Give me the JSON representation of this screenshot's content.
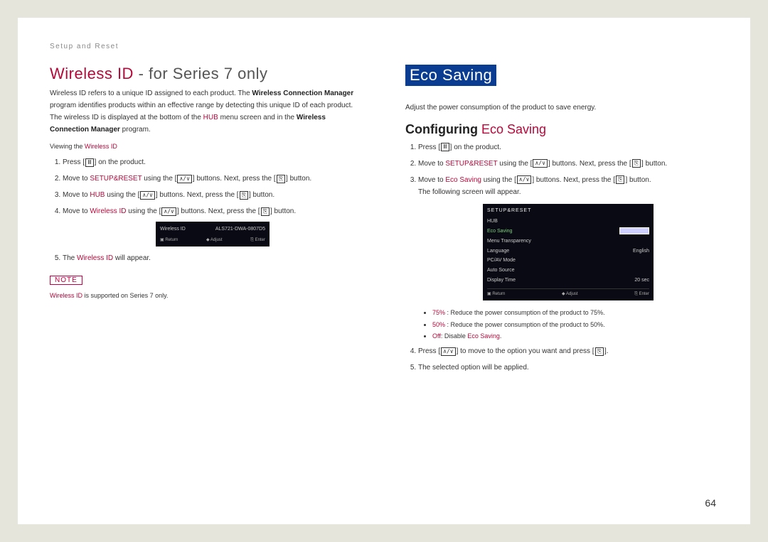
{
  "breadcrumb": "Setup and Reset",
  "left": {
    "h1_accent": "Wireless ID",
    "h1_rest": " - for Series 7 only",
    "intro_part1": "Wireless ID refers to a unique ID assigned to each product. The ",
    "intro_bold1": "Wireless Connection Manager",
    "intro_part2": " program identifies products within an effective range by detecting this unique ID of each product. The wireless ID is displayed at the bottom of the ",
    "intro_hl1": "HUB",
    "intro_part3": " menu screen and in the ",
    "intro_bold2": "Wireless Connection Manager",
    "intro_part4": " program.",
    "view_label_pre": "Viewing the ",
    "view_label_hl": "Wireless ID",
    "steps": {
      "s1_a": "Press [",
      "s1_b": "] on the product.",
      "s2_a": "Move to ",
      "s2_hl": "SETUP&RESET",
      "s2_b": " using the [",
      "s2_c": "] buttons. Next, press the [",
      "s2_d": "] button.",
      "s3_a": "Move to ",
      "s3_hl": "HUB",
      "s3_b": " using the [",
      "s3_c": "] buttons. Next, press the [",
      "s3_d": "] button.",
      "s4_a": "Move to ",
      "s4_hl": "Wireless ID",
      "s4_b": " using the [",
      "s4_c": "] buttons. Next, press the [",
      "s4_d": "] button.",
      "s5_a": "The ",
      "s5_hl": "Wireless ID",
      "s5_b": " will appear."
    },
    "osd": {
      "label": "Wireless ID",
      "value": "ALS721-DWA-0807D5",
      "f1": "Return",
      "f2": "Adjust",
      "f3": "Enter"
    },
    "note_badge": "NOTE",
    "note_hl": "Wireless ID",
    "note_rest": " is supported on Series 7 only."
  },
  "right": {
    "h1": "Eco Saving",
    "intro": "Adjust the power consumption of the product to save energy.",
    "h2_a": "Configuring ",
    "h2_b": "Eco Saving",
    "steps": {
      "s1_a": "Press [",
      "s1_b": "] on the product.",
      "s2_a": "Move to ",
      "s2_hl": "SETUP&RESET",
      "s2_b": " using the [",
      "s2_c": "] buttons. Next, press the [",
      "s2_d": "] button.",
      "s3_a": "Move to ",
      "s3_hl": "Eco Saving",
      "s3_b": " using the [",
      "s3_c": "] buttons. Next, press the [",
      "s3_d": "] button.",
      "s3_e": "The following screen will appear.",
      "s4_a": "Press [",
      "s4_b": "] to move to the option you want and press [",
      "s4_c": "].",
      "s5": "The selected option will be applied."
    },
    "osd": {
      "title": "SETUP&RESET",
      "items": [
        {
          "l": "HUB",
          "v": ""
        },
        {
          "l": "Eco Saving",
          "v": "",
          "sel": true
        },
        {
          "l": "Menu Transparency",
          "v": ""
        },
        {
          "l": "Language",
          "v": "English"
        },
        {
          "l": "PC/AV Mode",
          "v": ""
        },
        {
          "l": "Auto Source",
          "v": ""
        },
        {
          "l": "Display Time",
          "v": "20 sec"
        }
      ],
      "f1": "Return",
      "f2": "Adjust",
      "f3": "Enter"
    },
    "bullets": {
      "b1_hl": "75%",
      "b1": " : Reduce the power consumption of the product to 75%.",
      "b2_hl": "50%",
      "b2": " : Reduce the power consumption of the product to 50%.",
      "b3_hl": "Off",
      "b3_mid": ": Disable ",
      "b3_hl2": "Eco Saving",
      "b3_end": "."
    }
  },
  "page_number": "64"
}
